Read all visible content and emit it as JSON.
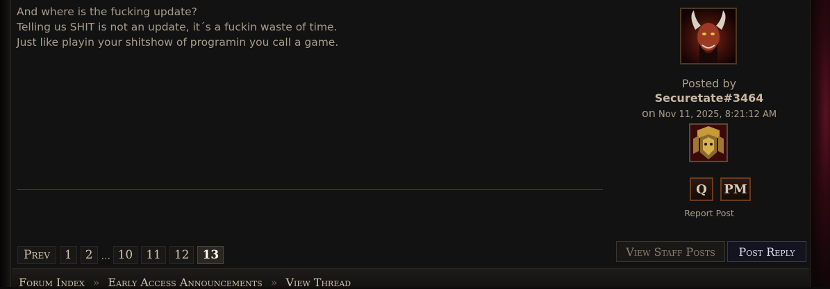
{
  "post": {
    "lines": [
      "And where is the fucking update?",
      "Telling us SHIT is not an update, it´s a fuckin waste of time.",
      "Just like playin your shitshow of programin you call a game."
    ]
  },
  "author": {
    "posted_by_label": "Posted by",
    "name": "Securetate#3464",
    "on_label": "on",
    "date": "Nov 11, 2025, 8:21:12 AM",
    "quote_label": "Q",
    "pm_label": "PM",
    "report_label": "Report Post"
  },
  "pagination": {
    "prev_label": "Prev",
    "pages_start": [
      "1",
      "2"
    ],
    "ellipsis": "...",
    "pages_end": [
      "10",
      "11",
      "12"
    ],
    "current": "13"
  },
  "actions": {
    "view_staff_label": "View Staff Posts",
    "post_reply_label": "Post Reply"
  },
  "breadcrumb": {
    "items": [
      "Forum Index",
      "Early Access Announcements",
      "View Thread"
    ],
    "separator": "»"
  },
  "colors": {
    "text": "#a89c8c",
    "author_name": "#c8b8a0",
    "button_border": "#6a3a1a",
    "reply_text": "#e0dcf0"
  }
}
